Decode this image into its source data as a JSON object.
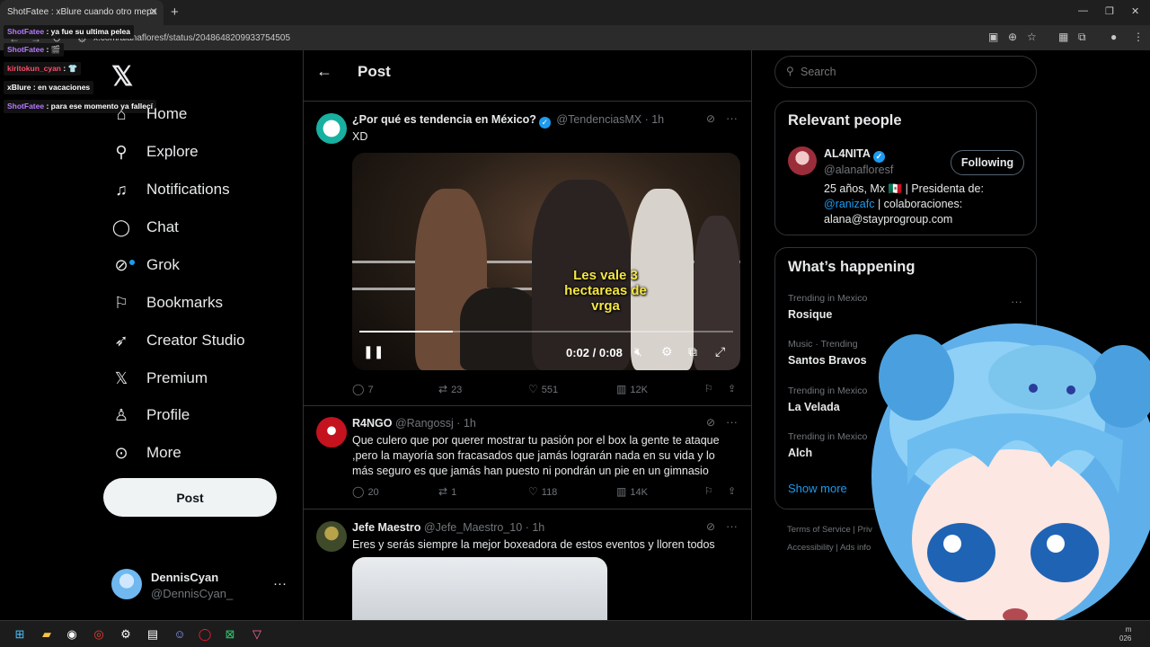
{
  "browser": {
    "tab_title": "ShotFatee : xBlure cuando otro mepa",
    "url": "x.com/alanafloresf/status/2048648209933754505",
    "new_tab": "+",
    "tab_close": "✕"
  },
  "chat": [
    {
      "user": "ShotFatee",
      "text": "ya fue su ultima pelea"
    },
    {
      "user": "ShotFatee",
      "text": "🎬"
    },
    {
      "user": "kiritokun_cyan",
      "text": "👕"
    },
    {
      "user": "xBlure",
      "text": "en vacaciones"
    },
    {
      "user": "ShotFatee",
      "text": "para ese momento ya fallecí"
    }
  ],
  "nav": {
    "items": [
      {
        "label": "Home",
        "icon": "home-icon"
      },
      {
        "label": "Explore",
        "icon": "search-icon"
      },
      {
        "label": "Notifications",
        "icon": "bell-icon"
      },
      {
        "label": "Chat",
        "icon": "chat-icon"
      },
      {
        "label": "Grok",
        "icon": "grok-icon"
      },
      {
        "label": "Bookmarks",
        "icon": "bookmark-icon"
      },
      {
        "label": "Creator Studio",
        "icon": "rocket-icon"
      },
      {
        "label": "Premium",
        "icon": "x-icon"
      },
      {
        "label": "Profile",
        "icon": "person-icon"
      },
      {
        "label": "More",
        "icon": "more-icon"
      }
    ],
    "post_button": "Post"
  },
  "account": {
    "name": "DennisCyan",
    "handle": "@DennisCyan_"
  },
  "main": {
    "header_title": "Post",
    "tweets": [
      {
        "name": "¿Por qué es tendencia en México?",
        "handle": "@TendenciasMX",
        "time": "· 1h",
        "text": "XD",
        "video": {
          "caption": "Les vale 3 hectareas de vrga",
          "time": "0:02 / 0:08",
          "progress": 0.25
        },
        "replies": "7",
        "reposts": "23",
        "likes": "551",
        "views": "12K"
      },
      {
        "name": "R4NGO",
        "handle": "@Rangossj",
        "time": "· 1h",
        "text": "Que culero que por querer mostrar tu pasión por el box la gente te ataque ,pero la mayoría son fracasados que jamás lograrán nada en su vida y lo más seguro es que jamás han puesto ni pondrán un pie en un gimnasio",
        "replies": "20",
        "reposts": "1",
        "likes": "118",
        "views": "14K"
      },
      {
        "name": "Jefe Maestro",
        "handle": "@Jefe_Maestro_10",
        "time": "· 1h",
        "text": "Eres y serás siempre la mejor boxeadora de estos eventos y lloren todos"
      }
    ]
  },
  "right": {
    "search_placeholder": "Search",
    "relevant_people_title": "Relevant people",
    "person": {
      "name": "AL4NITA",
      "handle": "@alanafloresf",
      "follow_label": "Following",
      "bio_1": "25 años, Mx 🇲🇽 | Presidenta de:",
      "bio_link": "@ranizafc",
      "bio_2": " | colaboraciones:",
      "bio_3": "alana@stayprogroup.com"
    },
    "happening_title": "What’s happening",
    "trends": [
      {
        "meta": "Trending in Mexico",
        "name": "Rosique"
      },
      {
        "meta": "Music · Trending",
        "name": "Santos Bravos"
      },
      {
        "meta": "Trending in Mexico",
        "name": "La Velada"
      },
      {
        "meta": "Trending in Mexico",
        "name": "Alch"
      }
    ],
    "show_more": "Show more",
    "footer_1": "Terms of Service  |  Priv",
    "footer_2": "Accessibility  |  Ads info"
  },
  "taskbar": {
    "tray_1": "m",
    "tray_2": "026"
  }
}
